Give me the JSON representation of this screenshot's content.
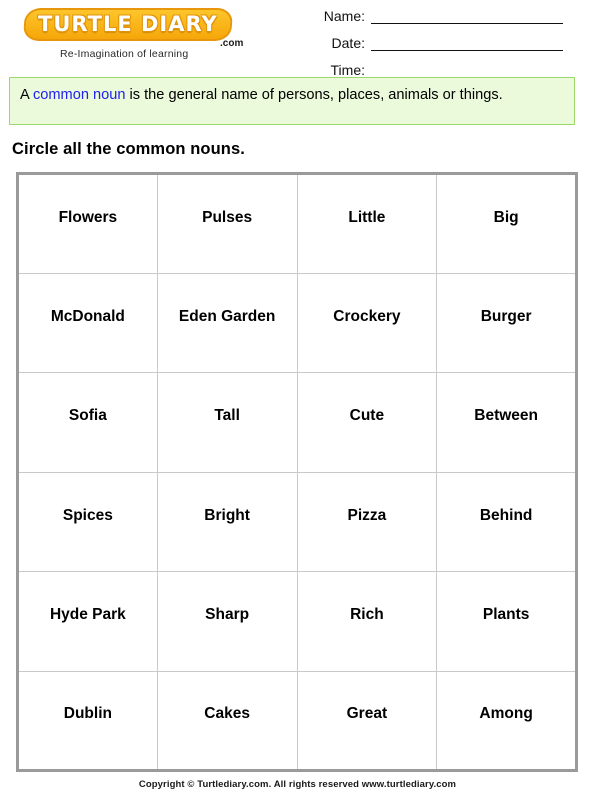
{
  "header": {
    "logo": {
      "wordmark": "TURTLE DIARY",
      "dotcom": ".com",
      "tagline": "Re-Imagination of learning"
    },
    "fields": [
      {
        "label": "Name:",
        "value": ""
      },
      {
        "label": "Date:",
        "value": ""
      },
      {
        "label": "Time:",
        "value": ""
      }
    ]
  },
  "definition": {
    "prefix": "A ",
    "keyword": "common noun",
    "suffix": " is the general name of persons, places, animals or things.",
    "keyword_color": "#2020ee",
    "background_color": "#eafada",
    "border_color": "#9ed86a"
  },
  "instruction": "Circle all the common nouns.",
  "table": {
    "columns": 4,
    "rows": [
      [
        "Flowers",
        "Pulses",
        "Little",
        "Big"
      ],
      [
        "McDonald",
        "Eden Garden",
        "Crockery",
        "Burger"
      ],
      [
        "Sofia",
        "Tall",
        "Cute",
        "Between"
      ],
      [
        "Spices",
        "Bright",
        "Pizza",
        "Behind"
      ],
      [
        "Hyde Park",
        "Sharp",
        "Rich",
        "Plants"
      ],
      [
        "Dublin",
        "Cakes",
        "Great",
        "Among"
      ]
    ],
    "border_color": "#9a9a9a",
    "cell_border_color": "#c9c9c9"
  },
  "footer": {
    "copyright": "Copyright © Turtlediary.com. All rights reserved www.turtlediary.com"
  }
}
